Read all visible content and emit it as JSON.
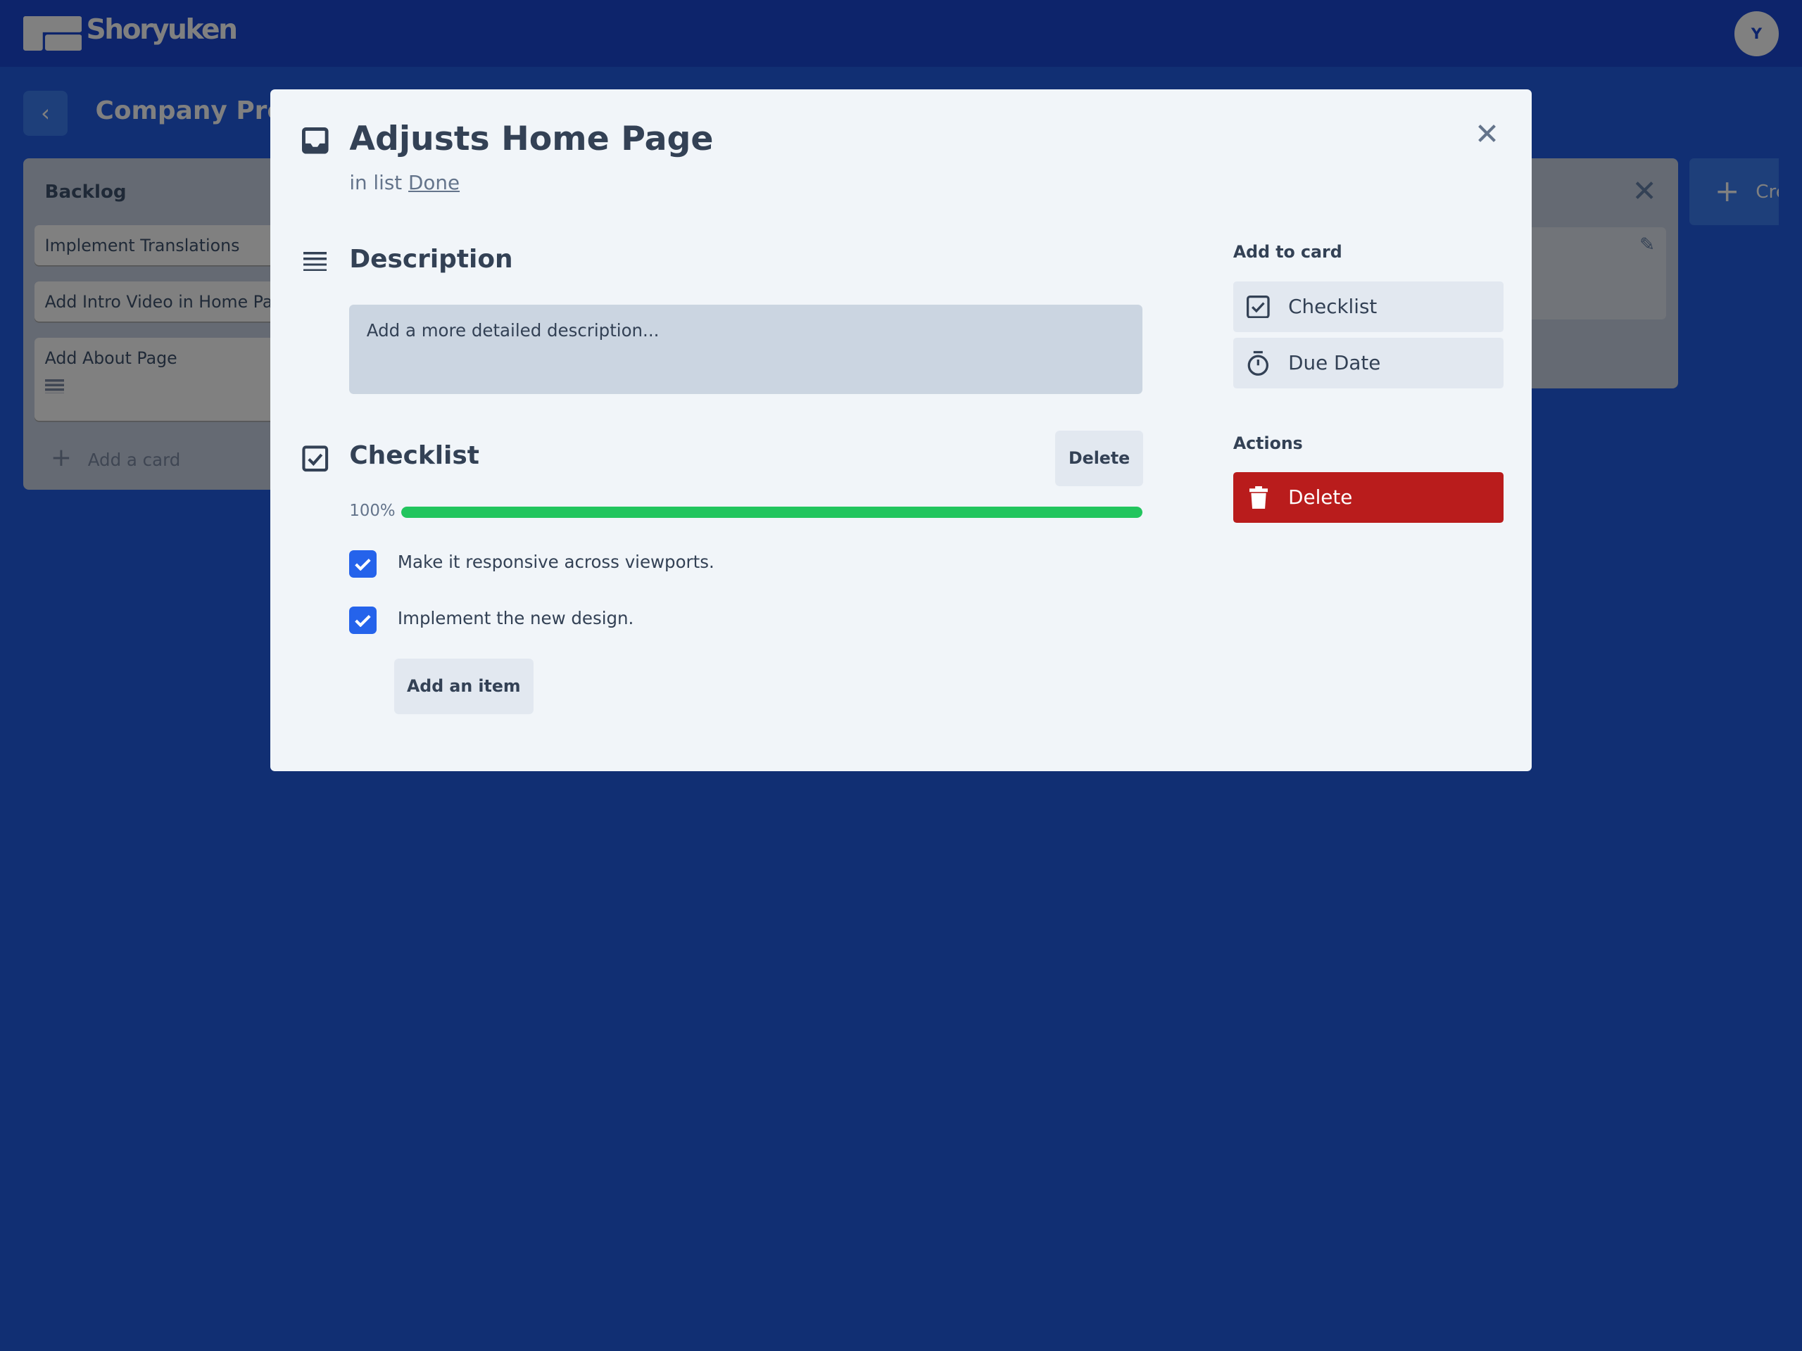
{
  "header": {
    "brand": "Shoryuken",
    "avatar_initial": "Y"
  },
  "board": {
    "title": "Company Pro",
    "create_label": "Cre"
  },
  "backlog": {
    "title": "Backlog",
    "cards": [
      "Implement Translations",
      "Add Intro Video in Home Pa",
      "Add About Page"
    ],
    "add_card": "Add a card"
  },
  "modal": {
    "title": "Adjusts Home Page",
    "in_list_prefix": "in list",
    "list_name": "Done",
    "description": {
      "heading": "Description",
      "placeholder": "Add a more detailed description..."
    },
    "checklist": {
      "heading": "Checklist",
      "delete_label": "Delete",
      "progress_label": "100%",
      "progress": 100,
      "items": [
        {
          "text": "Make it responsive across viewports.",
          "checked": true
        },
        {
          "text": "Implement the new design.",
          "checked": true
        }
      ],
      "add_item_label": "Add an item"
    },
    "sidebar": {
      "add_to_card": "Add to card",
      "checklist_label": "Checklist",
      "due_date_label": "Due Date",
      "actions": "Actions",
      "delete_label": "Delete"
    }
  },
  "colors": {
    "header": "#0d246b",
    "background": "#112f73",
    "progress": "#22c55e",
    "checkbox": "#2563eb",
    "danger": "#b91c1c"
  }
}
